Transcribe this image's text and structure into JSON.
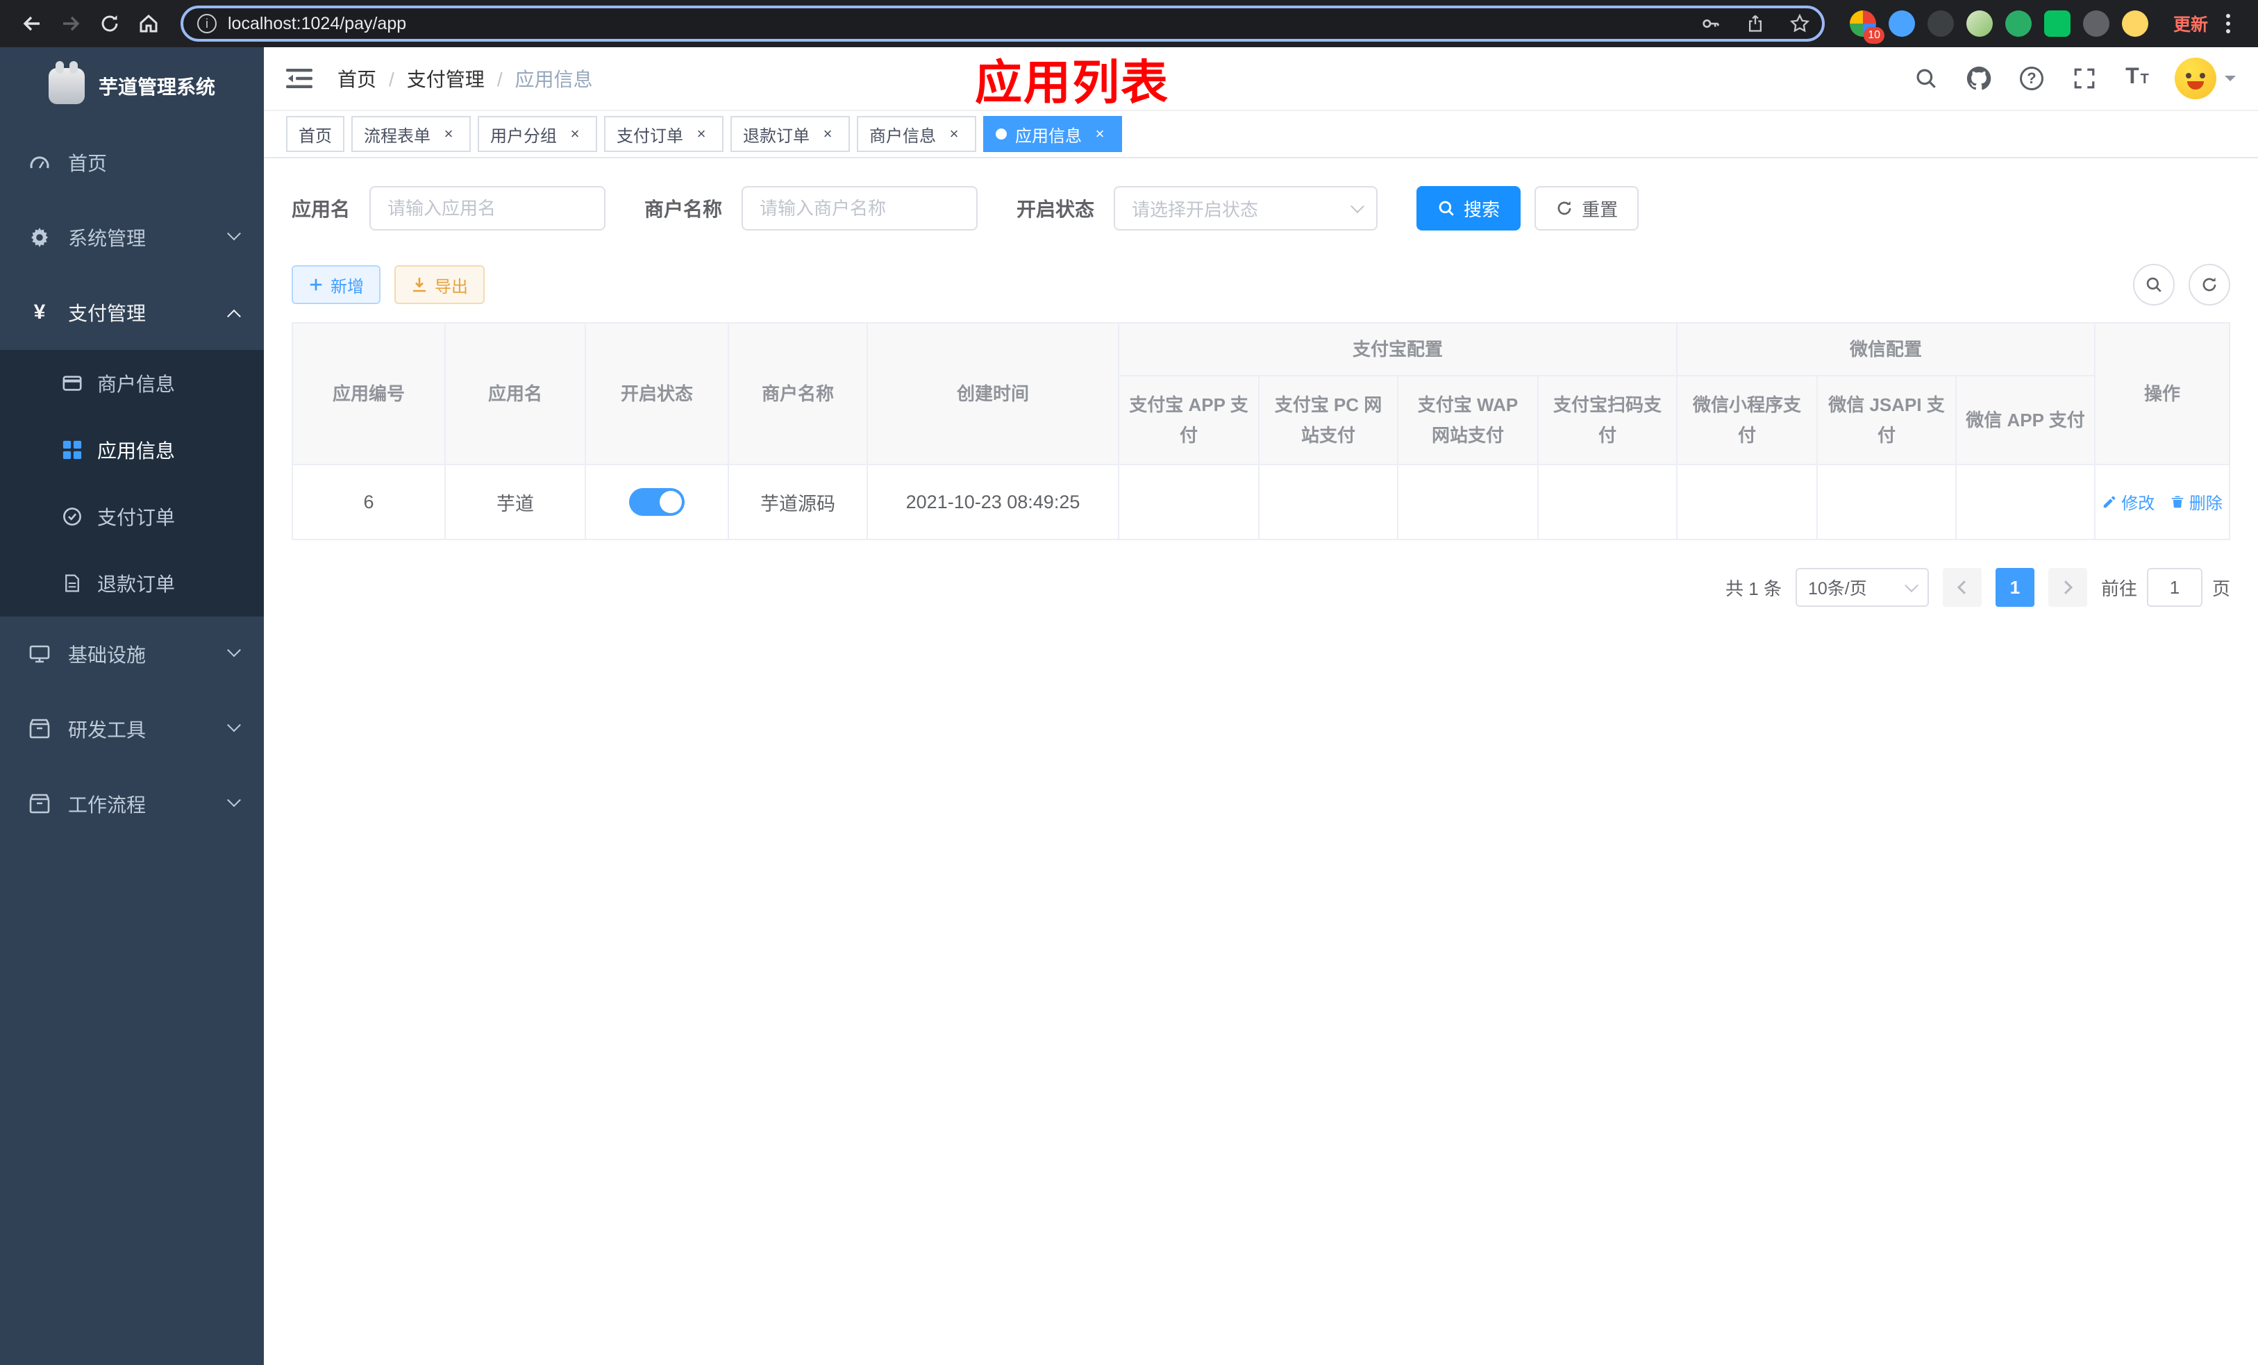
{
  "browser": {
    "url": "localhost:1024/pay/app",
    "update_label": "更新",
    "extension_badge": "10"
  },
  "sidebar": {
    "title": "芋道管理系统",
    "items": {
      "home": "首页",
      "system": "系统管理",
      "payment": "支付管理",
      "merchant": "商户信息",
      "app": "应用信息",
      "pay_order": "支付订单",
      "refund_order": "退款订单",
      "infra": "基础设施",
      "devtools": "研发工具",
      "workflow": "工作流程"
    }
  },
  "header": {
    "breadcrumb": {
      "home": "首页",
      "section": "支付管理",
      "page": "应用信息"
    },
    "annotation": "应用列表"
  },
  "tabs": [
    {
      "label": "首页"
    },
    {
      "label": "流程表单"
    },
    {
      "label": "用户分组"
    },
    {
      "label": "支付订单"
    },
    {
      "label": "退款订单"
    },
    {
      "label": "商户信息"
    },
    {
      "label": "应用信息"
    }
  ],
  "filters": {
    "app_name_label": "应用名",
    "app_name_placeholder": "请输入应用名",
    "merchant_label": "商户名称",
    "merchant_placeholder": "请输入商户名称",
    "status_label": "开启状态",
    "status_placeholder": "请选择开启状态",
    "search": "搜索",
    "reset": "重置"
  },
  "toolbar": {
    "add": "新增",
    "export": "导出"
  },
  "table": {
    "headers": {
      "id": "应用编号",
      "name": "应用名",
      "status": "开启状态",
      "merchant": "商户名称",
      "created": "创建时间",
      "alipay_group": "支付宝配置",
      "wechat_group": "微信配置",
      "alipay_app": "支付宝 APP 支付",
      "alipay_pc": "支付宝 PC 网站支付",
      "alipay_wap": "支付宝 WAP 网站支付",
      "alipay_qr": "支付宝扫码支付",
      "wx_mini": "微信小程序支付",
      "wx_jsapi": "微信 JSAPI 支付",
      "wx_app": "微信 APP 支付",
      "action": "操作"
    },
    "row": {
      "id": "6",
      "name": "芋道",
      "status_on": true,
      "merchant": "芋道源码",
      "created": "2021-10-23 08:49:25",
      "alipay_app": false,
      "alipay_pc": false,
      "alipay_wap": false,
      "alipay_qr": false,
      "wx_mini": false,
      "wx_jsapi": true,
      "wx_app": false,
      "edit": "修改",
      "delete": "删除"
    }
  },
  "pagination": {
    "total": "共 1 条",
    "page_size": "10条/页",
    "page": "1",
    "goto_label": "前往",
    "goto_value": "1",
    "goto_unit": "页"
  },
  "colors": {
    "primary": "#409eff",
    "danger": "#f35a5a",
    "success": "#13ce66",
    "warning": "#e6a23c",
    "annotation_red": "#ff0000",
    "sidebar_bg": "#304156",
    "submenu_bg": "#1f2d3d"
  }
}
